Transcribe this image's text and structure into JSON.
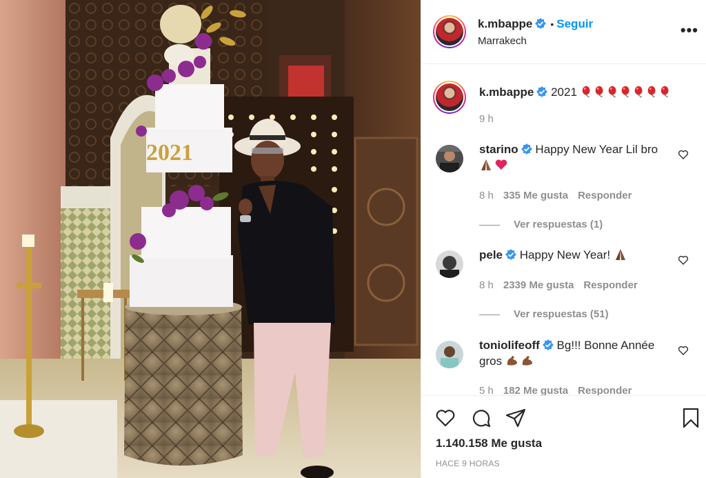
{
  "post": {
    "author": "k.mbappe",
    "follow_dot": "•",
    "follow_label": "Seguir",
    "location": "Marrakech",
    "more_label": "•••"
  },
  "caption": {
    "author": "k.mbappe",
    "text": "2021",
    "balloon_count": 7,
    "time": "9 h"
  },
  "comments": [
    {
      "author": "starino",
      "text": "Happy New Year Lil bro",
      "emojis": [
        "praying-hands",
        "red-heart"
      ],
      "time": "8 h",
      "likes": "335 Me gusta",
      "reply_label": "Responder",
      "view_replies": "Ver respuestas (1)"
    },
    {
      "author": "pele",
      "text": "Happy New Year!",
      "emojis": [
        "praying-hands"
      ],
      "time": "8 h",
      "likes": "2339 Me gusta",
      "reply_label": "Responder",
      "view_replies": "Ver respuestas (51)"
    },
    {
      "author": "toniolifeoff",
      "text": "Bg!!! Bonne Année gros",
      "emojis": [
        "flexed-biceps",
        "flexed-biceps"
      ],
      "time": "5 h",
      "likes": "182 Me gusta",
      "reply_label": "Responder"
    }
  ],
  "actions": {
    "likes_total": "1.140.158 Me gusta",
    "time_ago": "HACE 9 HORAS",
    "icons": [
      "heart-icon",
      "comment-icon",
      "share-icon",
      "bookmark-icon"
    ]
  },
  "photo": {
    "cake_text": "2021"
  },
  "colors": {
    "accent_blue": "#0095f6",
    "verified_blue": "#3897f0",
    "muted": "#8e8e8e",
    "text": "#262626"
  }
}
